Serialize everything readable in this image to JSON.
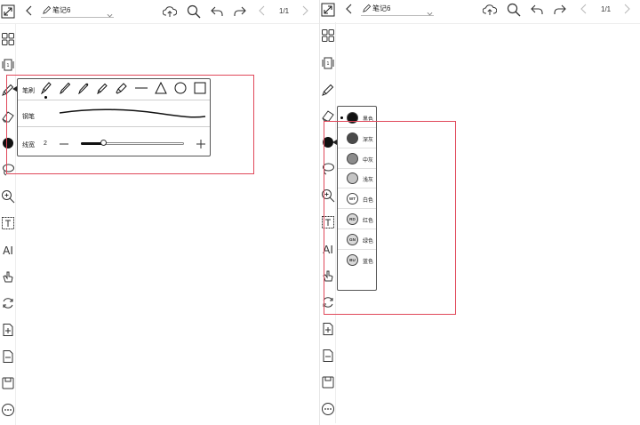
{
  "toolbar": {
    "note_title": "笔记6",
    "page_count": "1/1"
  },
  "pen_panel": {
    "brush_label": "笔刷",
    "pen_type_label": "钢笔",
    "line_width_label": "线宽",
    "line_width_value": "2",
    "line_width_fraction": 0.22
  },
  "color_panel": {
    "colors": [
      {
        "label": "黑色",
        "badge": "",
        "color": "#111111",
        "selected": true
      },
      {
        "label": "深灰",
        "badge": "",
        "color": "#4a4a4a",
        "selected": false
      },
      {
        "label": "中灰",
        "badge": "",
        "color": "#8c8c8c",
        "selected": false
      },
      {
        "label": "浅灰",
        "badge": "",
        "color": "#c4c4c4",
        "selected": false
      },
      {
        "label": "白色",
        "badge": "WT",
        "color": "#ffffff",
        "selected": false
      },
      {
        "label": "红色",
        "badge": "RD",
        "color": "#d9d9d9",
        "selected": false
      },
      {
        "label": "绿色",
        "badge": "GN",
        "color": "#d9d9d9",
        "selected": false
      },
      {
        "label": "蓝色",
        "badge": "BU",
        "color": "#d9d9d9",
        "selected": false
      }
    ]
  },
  "sidebar_tools": [
    "AI"
  ],
  "colors": {
    "highlight": "#e0485a",
    "current_pen_color": "#111111"
  }
}
